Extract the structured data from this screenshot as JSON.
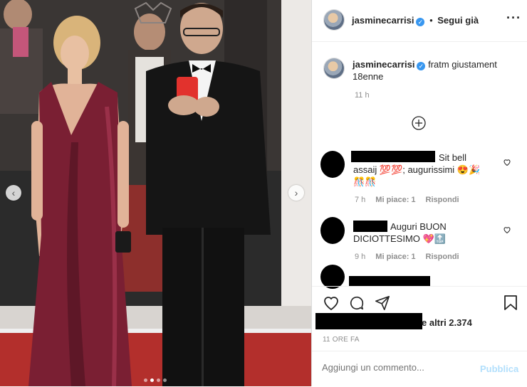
{
  "post": {
    "username": "jasminecarrisi",
    "follow_label": "Segui già",
    "caption": "fratm giustament 18enne",
    "caption_time": "11 h"
  },
  "comments": [
    {
      "text": "Sit bell assaij 💯💯; augurissimi 😍🎉🎊🎊",
      "time": "7 h",
      "likes": "Mi piace: 1",
      "reply": "Rispondi"
    },
    {
      "text": "Auguri BUON DICIOTTESIMO 💖🔝",
      "time": "9 h",
      "likes": "Mi piace: 1",
      "reply": "Rispondi"
    }
  ],
  "likes_suffix": "e altri 2.374",
  "timestamp": "11 ORE FA",
  "comment_input": {
    "placeholder": "Aggiungi un commento..."
  },
  "publish_label": "Pubblica",
  "carousel": {
    "total": 4,
    "active": 2
  }
}
